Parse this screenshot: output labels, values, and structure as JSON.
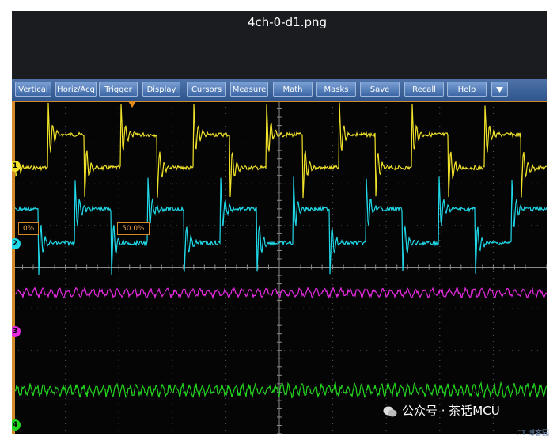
{
  "window": {
    "title": "4ch-0-d1.png"
  },
  "menu": {
    "items": [
      "Vertical",
      "Horiz/Acq",
      "Trigger",
      "Display",
      "Cursors",
      "Measure",
      "Math",
      "Masks",
      "Save",
      "Recall",
      "Help"
    ],
    "dropdown_icon": "triangle-down-icon"
  },
  "scope": {
    "background": "#050505",
    "grid_color": "#5a5a5a",
    "trigger_color": "#e08a1e",
    "channels": [
      {
        "label": "1",
        "color": "#f0e22a",
        "waveform": "square-with-ringing"
      },
      {
        "label": "2",
        "color": "#20d8e8",
        "waveform": "square-with-ringing"
      },
      {
        "label": "3",
        "color": "#e52ae0",
        "waveform": "noise"
      },
      {
        "label": "4",
        "color": "#22d61e",
        "waveform": "noise"
      }
    ],
    "percent_labels": [
      "0%",
      "50.0%"
    ]
  },
  "watermark": {
    "text": "公众号 · 茶话MCU",
    "sub": "CT 博客园"
  }
}
